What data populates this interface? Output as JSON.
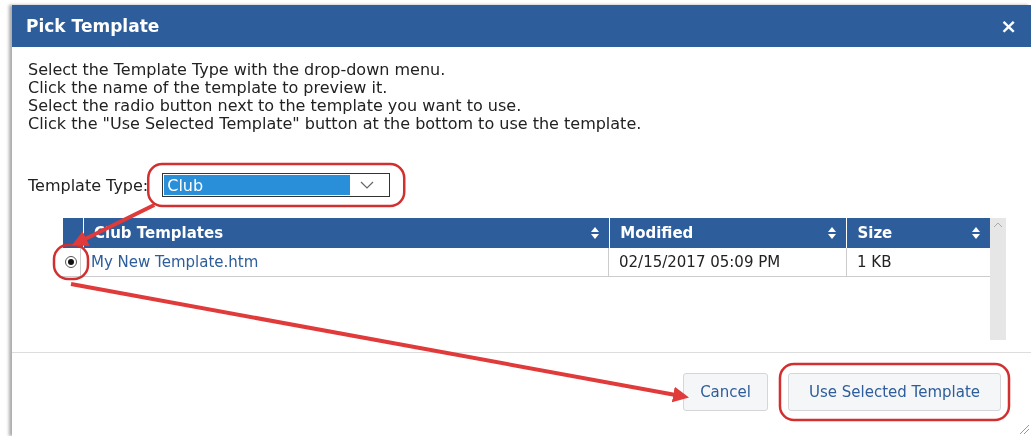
{
  "window": {
    "title": "Pick Template",
    "close": "×"
  },
  "instructions": [
    "Select the Template Type with the drop-down menu.",
    "Click the name of the template to preview it.",
    "Select the radio button next to the template you want to use.",
    "Click the \"Use Selected Template\" button at the bottom to use the template."
  ],
  "template_type": {
    "label": "Template Type:",
    "value": "Club"
  },
  "table": {
    "columns": [
      {
        "label": "Club Templates"
      },
      {
        "label": "Modified"
      },
      {
        "label": "Size"
      }
    ],
    "rows": [
      {
        "selected": true,
        "name": "My New Template.htm",
        "modified": "02/15/2017 05:09 PM",
        "size": "1 KB"
      }
    ]
  },
  "buttons": [
    {
      "label": "Cancel",
      "kind": "plain"
    },
    {
      "label": "Use Selected Template",
      "kind": "primary"
    }
  ]
}
